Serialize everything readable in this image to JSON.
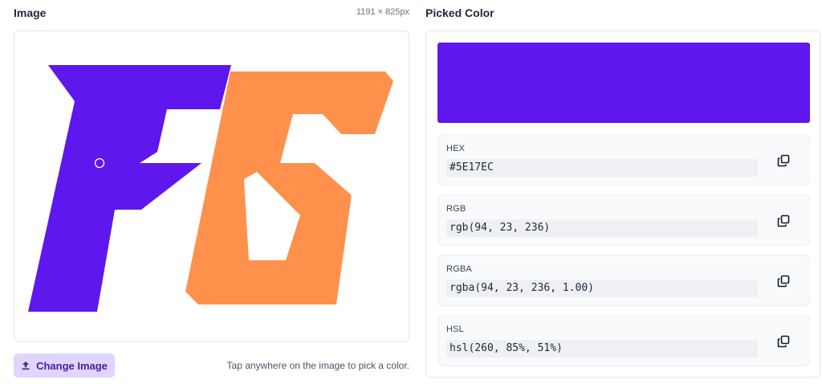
{
  "image_section": {
    "title": "Image",
    "dimensions": "1191 × 825px",
    "change_button_label": "Change Image",
    "hint": "Tap anywhere on the image to pick a color.",
    "logo_text": "FG",
    "colors": {
      "purple": "#5E17EC",
      "orange": "#FF914D"
    }
  },
  "picked_section": {
    "title": "Picked Color",
    "swatch_color": "#5E17EC",
    "values": [
      {
        "label": "HEX",
        "value": "#5E17EC"
      },
      {
        "label": "RGB",
        "value": "rgb(94, 23, 236)"
      },
      {
        "label": "RGBA",
        "value": "rgba(94, 23, 236, 1.00)"
      },
      {
        "label": "HSL",
        "value": "hsl(260, 85%, 51%)"
      }
    ]
  }
}
